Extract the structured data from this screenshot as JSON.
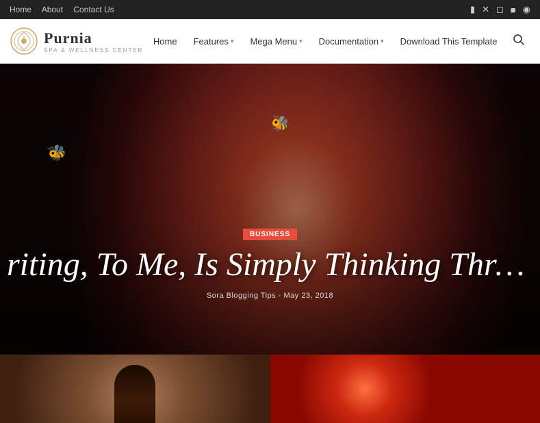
{
  "topbar": {
    "links": [
      {
        "label": "Home",
        "href": "#"
      },
      {
        "label": "About",
        "href": "#"
      },
      {
        "label": "Contact Us",
        "href": "#"
      }
    ],
    "social_icons": [
      {
        "name": "facebook-icon",
        "symbol": "f"
      },
      {
        "name": "twitter-x-icon",
        "symbol": "✕"
      },
      {
        "name": "instagram-icon",
        "symbol": "◻"
      },
      {
        "name": "pinterest-icon",
        "symbol": "p"
      },
      {
        "name": "skype-icon",
        "symbol": "s"
      }
    ]
  },
  "header": {
    "logo_name": "Purnia",
    "logo_tagline": "SPA & WELLNESS CENTER",
    "nav_items": [
      {
        "label": "Home",
        "has_dropdown": false
      },
      {
        "label": "Features",
        "has_dropdown": true
      },
      {
        "label": "Mega Menu",
        "has_dropdown": true
      },
      {
        "label": "Documentation",
        "has_dropdown": true
      },
      {
        "label": "Download This Template",
        "has_dropdown": false
      }
    ]
  },
  "hero": {
    "badge": "BUSINESS",
    "title": "riting, To Me, Is Simply Thinking Through My Fin",
    "meta_author": "Sora Blogging Tips",
    "meta_separator": "-",
    "meta_date": "May 23, 2018"
  },
  "grid": {
    "left_alt": "Portrait photo",
    "right_alt": "Red abstract circles"
  }
}
